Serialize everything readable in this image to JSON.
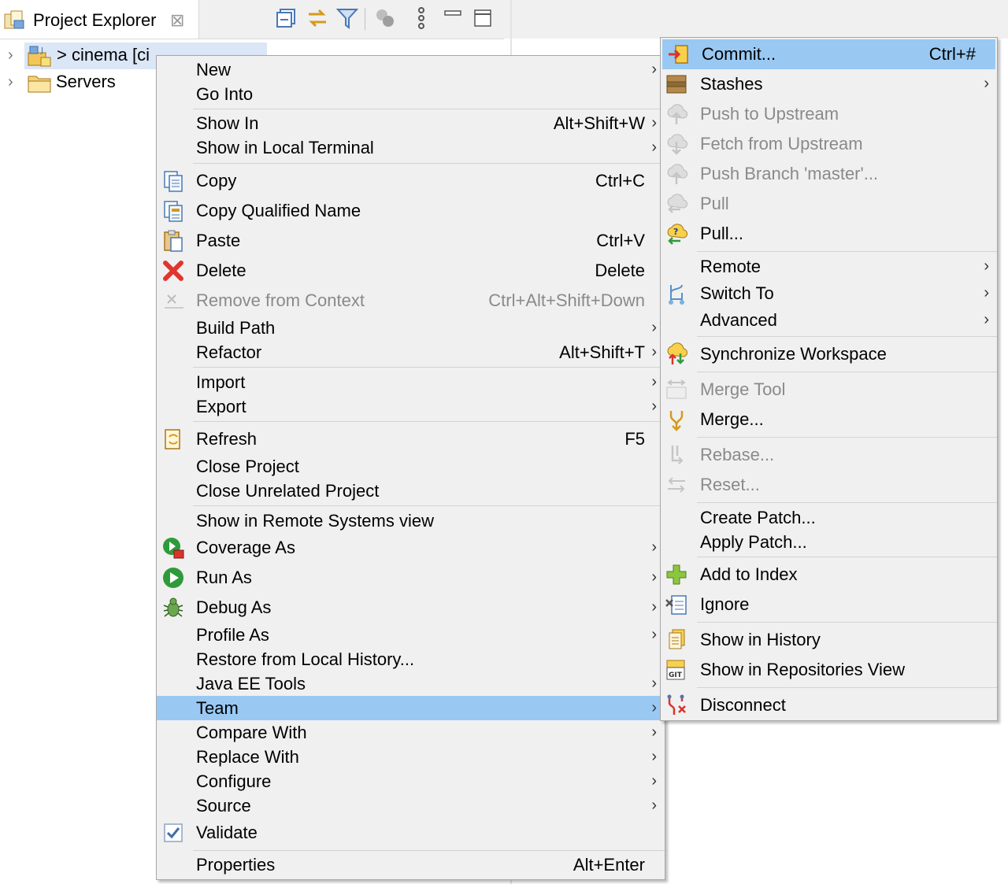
{
  "view": {
    "tab_title": "Project Explorer",
    "close_glyph": "⊠",
    "toolbar": [
      "collapse-all-icon",
      "link-with-editor-icon",
      "filter-icon",
      "git-actions-icon",
      "view-menu-icon",
      "minimize-icon",
      "maximize-icon"
    ]
  },
  "tree": {
    "cinema_label": "> cinema [ci",
    "servers_label": "Servers"
  },
  "context_menu": {
    "new": "New",
    "go_into": "Go Into",
    "show_in": "Show In",
    "show_in_sc": "Alt+Shift+W",
    "show_local_terminal": "Show in Local Terminal",
    "copy": "Copy",
    "copy_sc": "Ctrl+C",
    "copy_qualified": "Copy Qualified Name",
    "paste": "Paste",
    "paste_sc": "Ctrl+V",
    "delete": "Delete",
    "delete_sc": "Delete",
    "remove_context": "Remove from Context",
    "remove_context_sc": "Ctrl+Alt+Shift+Down",
    "build_path": "Build Path",
    "refactor": "Refactor",
    "refactor_sc": "Alt+Shift+T",
    "import": "Import",
    "export": "Export",
    "refresh": "Refresh",
    "refresh_sc": "F5",
    "close_project": "Close Project",
    "close_unrelated": "Close Unrelated Project",
    "show_remote": "Show in Remote Systems view",
    "coverage_as": "Coverage As",
    "run_as": "Run As",
    "debug_as": "Debug As",
    "profile_as": "Profile As",
    "restore_history": "Restore from Local History...",
    "javaee_tools": "Java EE Tools",
    "team": "Team",
    "compare_with": "Compare With",
    "replace_with": "Replace With",
    "configure": "Configure",
    "source": "Source",
    "validate": "Validate",
    "properties": "Properties",
    "properties_sc": "Alt+Enter"
  },
  "team_menu": {
    "commit": "Commit...",
    "commit_sc": "Ctrl+#",
    "stashes": "Stashes",
    "push_upstream": "Push to Upstream",
    "fetch_upstream": "Fetch from Upstream",
    "push_branch": "Push Branch 'master'...",
    "pull": "Pull",
    "pull_dots": "Pull...",
    "remote": "Remote",
    "switch_to": "Switch To",
    "advanced": "Advanced",
    "synchronize": "Synchronize Workspace",
    "merge_tool": "Merge Tool",
    "merge": "Merge...",
    "rebase": "Rebase...",
    "reset": "Reset...",
    "create_patch": "Create Patch...",
    "apply_patch": "Apply Patch...",
    "add_index": "Add to Index",
    "ignore": "Ignore",
    "show_history": "Show in History",
    "show_repositories": "Show in Repositories View",
    "disconnect": "Disconnect"
  },
  "colors": {
    "highlight": "#99c9f3",
    "menu_bg": "#f0f0f0",
    "disabled_text": "#8a8a8a"
  }
}
